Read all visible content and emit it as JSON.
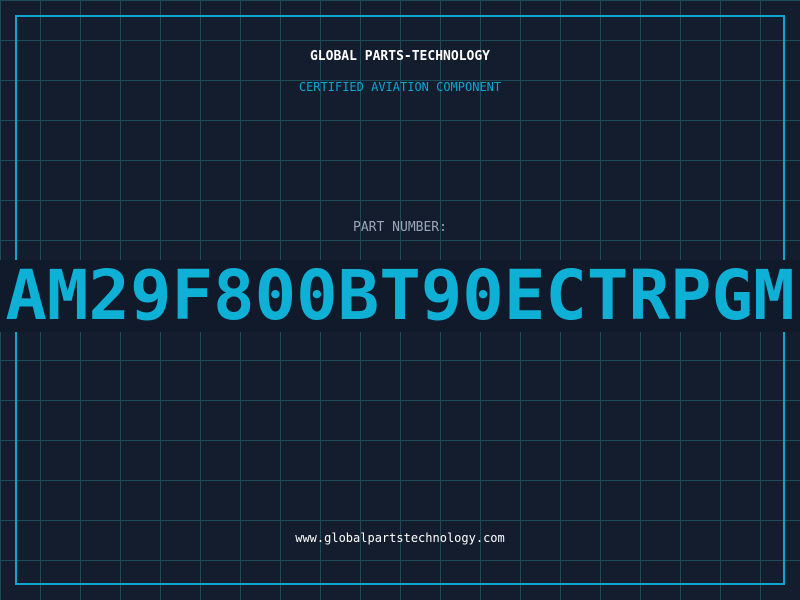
{
  "header": {
    "company": "GLOBAL PARTS-TECHNOLOGY",
    "subtitle": "CERTIFIED AVIATION COMPONENT"
  },
  "part": {
    "label": "PART NUMBER:",
    "number": "AM29F800BT90ECTRPGM"
  },
  "footer": {
    "website": "www.globalpartstechnology.com"
  },
  "colors": {
    "background": "#141d2e",
    "grid": "#1e4b5c",
    "accent": "#0ea5d0",
    "part_number": "#0fb0d6",
    "label": "#9aa7b8",
    "text": "#ffffff"
  }
}
